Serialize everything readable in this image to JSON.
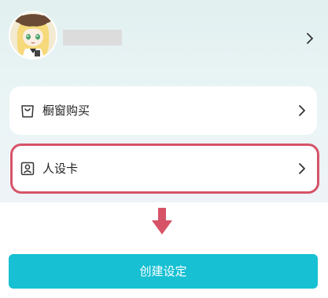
{
  "profile": {
    "avatar_icon": "anime-avatar",
    "chevron_icon": "chevron-right-icon"
  },
  "menu": {
    "items": [
      {
        "label": "橱窗购买",
        "icon": "shopping-bag-icon"
      },
      {
        "label": "人设卡",
        "icon": "person-card-icon"
      }
    ]
  },
  "highlight": {
    "color": "#d65367",
    "target": "人设卡"
  },
  "pointer": {
    "icon": "down-arrow-icon",
    "color": "#d65367"
  },
  "create_button": {
    "label": "创建设定",
    "color": "#17c0d3"
  }
}
